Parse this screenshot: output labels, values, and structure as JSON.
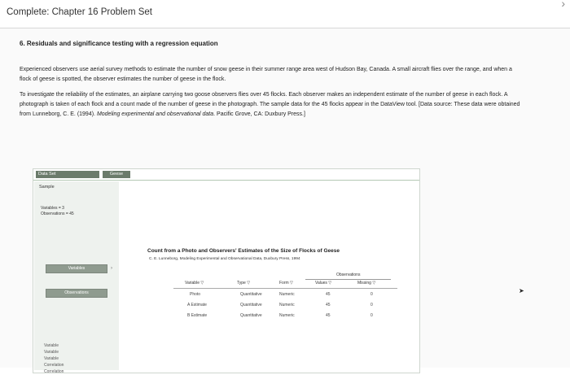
{
  "window": {
    "title": "Complete: Chapter 16 Problem Set",
    "chevron": "›"
  },
  "problem": {
    "heading": "6. Residuals and significance testing with a regression equation",
    "para1": "Experienced observers use aerial survey methods to estimate the number of snow geese in their summer range area west of Hudson Bay, Canada. A small aircraft flies over the range, and when a flock of geese is spotted, the observer estimates the number of geese in the flock.",
    "para2_plain": "To investigate the reliability of the estimates, an airplane carrying two goose observers flies over 45 flocks. Each observer makes an independent estimate of the number of geese in each flock. A photograph is taken of each flock and a count made of the number of geese in the photograph. The sample data for the 45 flocks appear in the DataView tool. [Data source: These data were obtained from Lunneborg, C. E. (1994). ",
    "para2_italic": "Modeling experimental and observational data",
    "para2_end": ". Pacific Grove, CA: Duxbury Press.]"
  },
  "dataview": {
    "tabs": {
      "dataset": "Data Set",
      "geese": "Geese"
    },
    "sample_label": "Sample",
    "variables_count": "Variables = 3",
    "observations_count": "Observations = 45",
    "variables_button": "Variables",
    "observations_button": "Observations",
    "side_list": [
      "Variable",
      "Variable",
      "Variable",
      "Correlation",
      "Correlation"
    ],
    "table_title": "Count from a Photo and Observers' Estimates of the Size of Flocks of Geese",
    "table_source": "C. E. Lunneborg, Modeling Experimental and Observational Data, Duxbury Press, 1994",
    "observations_header": "Observations",
    "columns": [
      "Variable",
      "Type",
      "Form",
      "Values",
      "Missing"
    ],
    "rows": [
      {
        "variable": "Photo",
        "type": "Quantitative",
        "form": "Numeric",
        "values": "45",
        "missing": "0"
      },
      {
        "variable": "A Estimate",
        "type": "Quantitative",
        "form": "Numeric",
        "values": "45",
        "missing": "0"
      },
      {
        "variable": "B Estimate",
        "type": "Quantitative",
        "form": "Numeric",
        "values": "45",
        "missing": "0"
      }
    ]
  }
}
